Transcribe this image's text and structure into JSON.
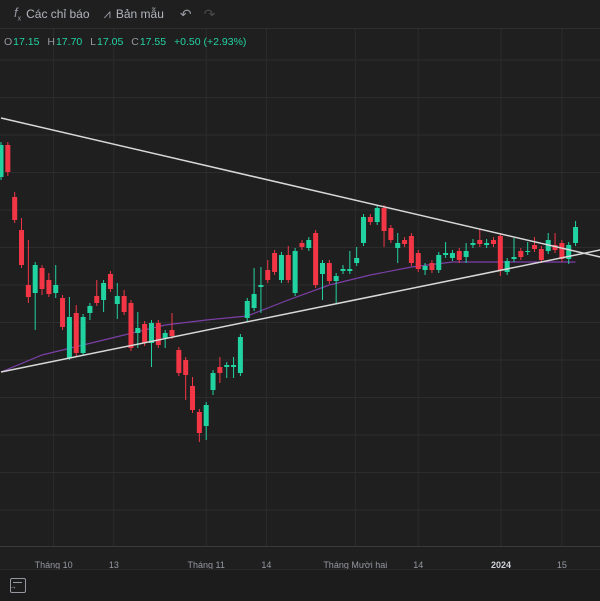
{
  "toolbar": {
    "indicators_label": "Các chỉ báo",
    "indicators_icon": "fx-icon",
    "templates_label": "Bản mẫu",
    "templates_icon": "templates-icon",
    "undo_icon": "undo-icon",
    "redo_icon": "redo-icon"
  },
  "legend": {
    "o_key": "O",
    "o_val": "17.15",
    "h_key": "H",
    "h_val": "17.70",
    "l_key": "L",
    "l_val": "17.05",
    "c_key": "C",
    "c_val": "17.55",
    "change": "+0.50 (+2.93%)"
  },
  "colors": {
    "up": "#22d3a2",
    "down": "#f23645",
    "ma": "#7b3fa6",
    "trendline": "#d8d8d8",
    "grid": "#2c2c2c"
  },
  "chart_data": {
    "type": "candlestick",
    "ohlc": [
      [
        20.1,
        21.85,
        19.95,
        21.7
      ],
      [
        21.7,
        21.85,
        20.15,
        20.35
      ],
      [
        19.1,
        19.35,
        17.8,
        17.95
      ],
      [
        17.45,
        18.05,
        15.55,
        15.7
      ],
      [
        14.7,
        16.95,
        13.8,
        14.1
      ],
      [
        14.3,
        15.85,
        12.45,
        15.7
      ],
      [
        15.55,
        15.7,
        14.2,
        14.5
      ],
      [
        14.95,
        15.3,
        14.1,
        14.25
      ],
      [
        14.3,
        15.7,
        14.05,
        14.7
      ],
      [
        14.05,
        14.2,
        12.45,
        12.6
      ],
      [
        11.05,
        14.1,
        10.95,
        13.1
      ],
      [
        13.3,
        13.7,
        11.15,
        11.3
      ],
      [
        11.3,
        13.25,
        11.15,
        13.1
      ],
      [
        13.3,
        13.8,
        12.95,
        13.65
      ],
      [
        14.15,
        14.95,
        13.65,
        13.8
      ],
      [
        13.95,
        14.95,
        13.35,
        14.8
      ],
      [
        15.25,
        15.4,
        14.35,
        14.5
      ],
      [
        13.75,
        14.8,
        13.0,
        14.15
      ],
      [
        14.15,
        14.45,
        13.2,
        13.35
      ],
      [
        13.8,
        13.95,
        11.4,
        11.55
      ],
      [
        12.3,
        13.35,
        11.55,
        12.55
      ],
      [
        12.75,
        12.9,
        11.65,
        11.8
      ],
      [
        11.8,
        12.95,
        10.6,
        12.8
      ],
      [
        12.8,
        12.95,
        11.55,
        11.7
      ],
      [
        12.05,
        12.45,
        11.55,
        12.3
      ],
      [
        12.45,
        13.3,
        12.0,
        12.15
      ],
      [
        11.45,
        11.6,
        10.15,
        10.3
      ],
      [
        10.95,
        11.1,
        8.95,
        10.2
      ],
      [
        9.65,
        10.1,
        8.3,
        8.45
      ],
      [
        8.35,
        8.5,
        6.85,
        7.3
      ],
      [
        7.65,
        8.85,
        6.95,
        8.7
      ],
      [
        9.45,
        10.45,
        9.2,
        10.3
      ],
      [
        10.6,
        11.1,
        9.8,
        10.3
      ],
      [
        10.6,
        10.85,
        10.05,
        10.7
      ],
      [
        10.6,
        11.1,
        10.05,
        10.7
      ],
      [
        10.3,
        12.25,
        10.15,
        12.1
      ],
      [
        13.05,
        14.05,
        12.85,
        13.9
      ],
      [
        13.55,
        15.55,
        13.4,
        14.25
      ],
      [
        14.6,
        15.6,
        13.3,
        14.7
      ],
      [
        15.45,
        15.95,
        14.8,
        14.95
      ],
      [
        16.3,
        16.45,
        15.2,
        15.35
      ],
      [
        14.95,
        16.35,
        14.8,
        16.2
      ],
      [
        16.2,
        16.65,
        14.8,
        14.95
      ],
      [
        14.3,
        16.55,
        14.15,
        16.4
      ],
      [
        16.8,
        16.95,
        16.45,
        16.6
      ],
      [
        16.55,
        17.1,
        16.4,
        16.95
      ],
      [
        17.3,
        17.45,
        14.55,
        14.7
      ],
      [
        15.25,
        15.95,
        13.95,
        15.8
      ],
      [
        15.8,
        15.95,
        14.75,
        14.9
      ],
      [
        14.9,
        15.3,
        13.8,
        15.15
      ],
      [
        15.4,
        15.7,
        15.25,
        15.5
      ],
      [
        15.4,
        16.4,
        15.25,
        15.5
      ],
      [
        15.8,
        16.6,
        15.65,
        16.05
      ],
      [
        16.8,
        18.25,
        16.65,
        18.1
      ],
      [
        18.1,
        18.25,
        17.7,
        17.85
      ],
      [
        17.85,
        18.7,
        17.7,
        18.55
      ],
      [
        18.55,
        18.7,
        16.6,
        17.4
      ],
      [
        17.55,
        17.7,
        16.8,
        16.95
      ],
      [
        16.55,
        17.3,
        15.8,
        16.8
      ],
      [
        16.95,
        17.1,
        16.6,
        16.75
      ],
      [
        17.15,
        17.3,
        15.65,
        15.8
      ],
      [
        16.3,
        16.45,
        15.35,
        15.5
      ],
      [
        15.45,
        15.8,
        15.2,
        15.65
      ],
      [
        15.8,
        15.95,
        15.3,
        15.45
      ],
      [
        15.45,
        16.35,
        15.3,
        16.2
      ],
      [
        16.2,
        16.85,
        16.05,
        16.3
      ],
      [
        16.05,
        16.45,
        15.9,
        16.3
      ],
      [
        16.4,
        16.55,
        15.8,
        15.95
      ],
      [
        16.1,
        16.8,
        15.8,
        16.4
      ],
      [
        16.7,
        17.0,
        16.55,
        16.8
      ],
      [
        16.95,
        17.5,
        16.6,
        16.75
      ],
      [
        16.7,
        17.0,
        16.55,
        16.8
      ],
      [
        16.95,
        17.1,
        16.6,
        16.75
      ],
      [
        17.15,
        17.3,
        15.15,
        15.45
      ],
      [
        15.35,
        16.05,
        15.2,
        15.9
      ],
      [
        16.0,
        17.05,
        15.85,
        16.1
      ],
      [
        16.4,
        16.55,
        15.95,
        16.1
      ],
      [
        16.35,
        16.85,
        16.2,
        16.4
      ],
      [
        16.7,
        17.1,
        16.35,
        16.5
      ],
      [
        16.5,
        16.65,
        15.8,
        15.95
      ],
      [
        16.4,
        17.3,
        16.25,
        16.95
      ],
      [
        16.7,
        17.3,
        16.3,
        16.45
      ],
      [
        16.8,
        16.95,
        15.85,
        16.0
      ],
      [
        16.0,
        16.85,
        15.75,
        16.7
      ],
      [
        16.8,
        17.9,
        16.65,
        17.6
      ]
    ],
    "moving_average": {
      "index": [
        0,
        6,
        12,
        18,
        24,
        30,
        36,
        42,
        48,
        54,
        60,
        66,
        72,
        78,
        84
      ],
      "values": [
        10.35,
        11.2,
        11.7,
        12.2,
        12.7,
        12.95,
        13.15,
        13.95,
        14.7,
        15.2,
        15.6,
        15.85,
        15.85,
        15.85,
        15.85
      ]
    },
    "trendlines": [
      {
        "name": "upper",
        "from": [
          0,
          23.05
        ],
        "to": [
          87.6,
          16.1
        ]
      },
      {
        "name": "lower",
        "from": [
          0,
          10.35
        ],
        "to": [
          87.6,
          16.45
        ]
      }
    ],
    "x_ticks": [
      {
        "index": 7.7,
        "label": "Tháng 10"
      },
      {
        "index": 16.5,
        "label": "13"
      },
      {
        "index": 30,
        "label": "Tháng 11"
      },
      {
        "index": 38.8,
        "label": "14"
      },
      {
        "index": 51.8,
        "label": "Tháng Mười hai"
      },
      {
        "index": 61,
        "label": "14"
      },
      {
        "index": 73.1,
        "label": "2024",
        "bold": true
      },
      {
        "index": 82,
        "label": "15"
      }
    ],
    "grid": true
  },
  "bottombar": {
    "icon": "go-to-date-icon"
  }
}
